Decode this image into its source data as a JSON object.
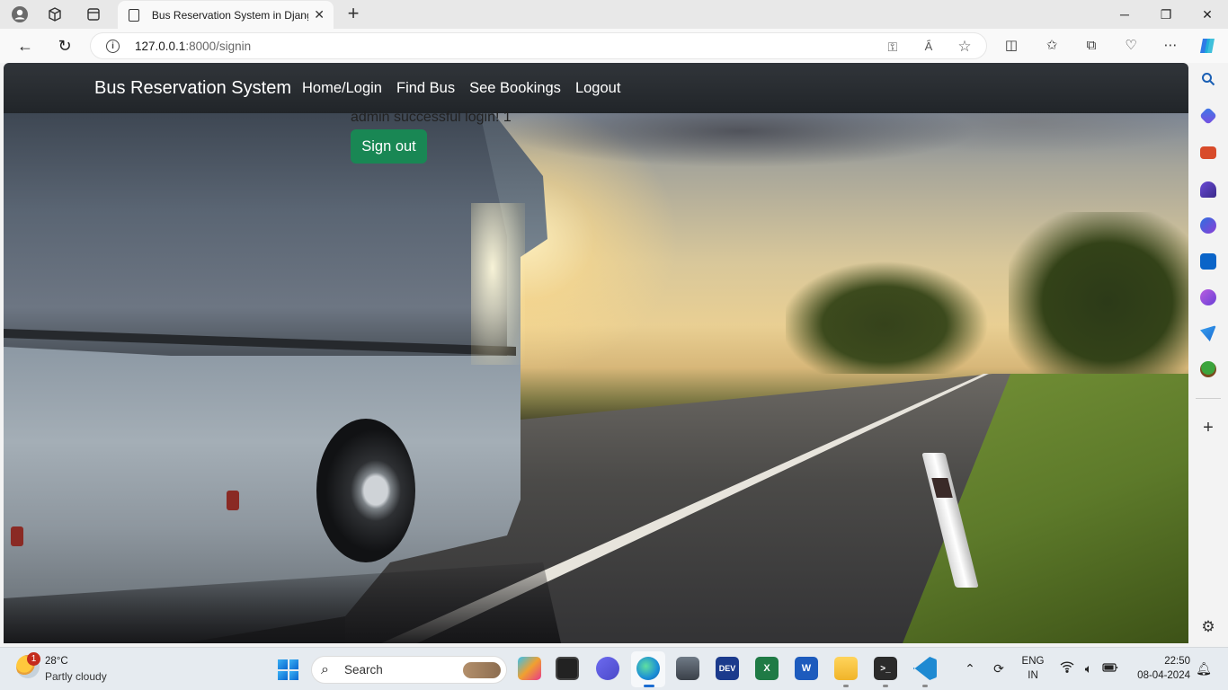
{
  "browser": {
    "tab_title": "Bus Reservation System in Djang",
    "url_host": "127.0.0.1",
    "url_rest": ":8000/signin"
  },
  "site": {
    "brand": "Bus Reservation System",
    "nav": [
      "Home/Login",
      "Find Bus",
      "See Bookings",
      "Logout"
    ],
    "message": "admin successful login! 1",
    "signout_label": "Sign out",
    "button_color": "#198754"
  },
  "taskbar": {
    "weather_badge": "1",
    "temperature": "28°C",
    "condition": "Partly cloudy",
    "search_label": "Search",
    "lang_top": "ENG",
    "lang_bottom": "IN",
    "time": "22:50",
    "date": "08-04-2024"
  }
}
